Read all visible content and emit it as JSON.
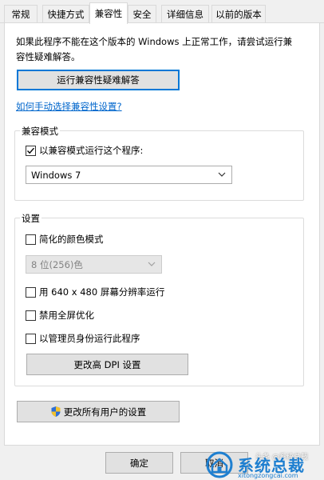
{
  "tabs": [
    {
      "label": "常规"
    },
    {
      "label": "快捷方式"
    },
    {
      "label": "兼容性",
      "active": true
    },
    {
      "label": "安全"
    },
    {
      "label": "详细信息"
    },
    {
      "label": "以前的版本"
    }
  ],
  "description": {
    "line1": "如果此程序不能在这个版本的 Windows 上正常工作，请尝试运行兼",
    "line2": "容性疑难解答。"
  },
  "troubleshooter_button": "运行兼容性疑难解答",
  "manual_link": "如何手动选择兼容性设置?",
  "compat_mode": {
    "legend": "兼容模式",
    "checkbox_label": "以兼容模式运行这个程序:",
    "checked": true,
    "selected_os": "Windows 7"
  },
  "settings": {
    "legend": "设置",
    "reduced_color_label": "简化的颜色模式",
    "reduced_color_checked": false,
    "color_option": "8 位(256)色",
    "res_640_label": "用 640 x 480 屏幕分辨率运行",
    "res_640_checked": false,
    "disable_fullscreen_label": "禁用全屏优化",
    "disable_fullscreen_checked": false,
    "run_as_admin_label": "以管理员身份运行此程序",
    "run_as_admin_checked": false,
    "dpi_button": "更改高 DPI 设置"
  },
  "all_users_button": "更改所有用户的设置",
  "footer": {
    "ok_button": "确定",
    "cancel_button": "取消"
  },
  "watermark": {
    "brand": "系统总裁",
    "url": "xitongzongcai.com",
    "overlay": "头条 @系统总裁"
  },
  "colors": {
    "accent": "#0078d7",
    "link": "#0066cc",
    "panel": "#ffffff",
    "window": "#f0f0f0"
  }
}
